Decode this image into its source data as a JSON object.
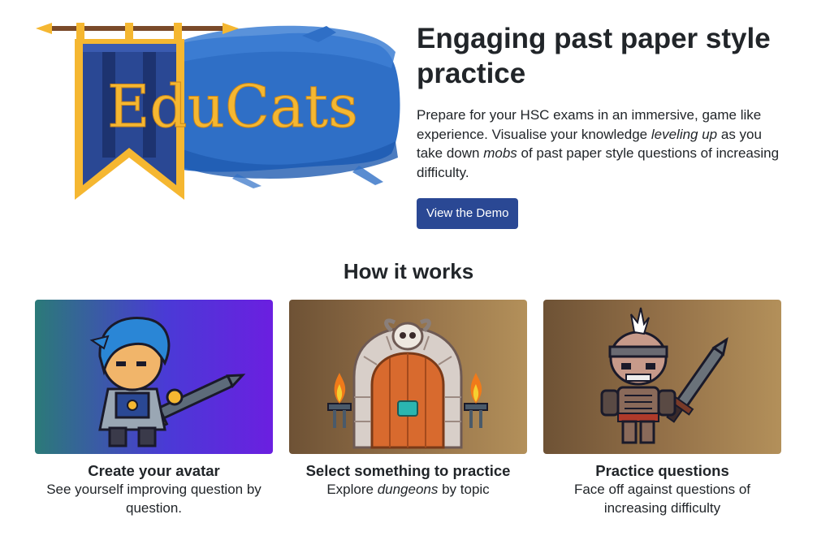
{
  "logo": {
    "text": "EduCats"
  },
  "hero": {
    "title": "Engaging past paper style practice",
    "description_parts": [
      {
        "text": "Prepare for your HSC exams in an immersive, game like experience. Visualise your knowledge ",
        "italic": false
      },
      {
        "text": "leveling up",
        "italic": true
      },
      {
        "text": " as you take down ",
        "italic": false
      },
      {
        "text": "mobs",
        "italic": true
      },
      {
        "text": " of past paper style questions of increasing difficulty.",
        "italic": false
      }
    ],
    "button_label": "View the Demo"
  },
  "how_it_works": {
    "title": "How it works",
    "cards": [
      {
        "title": "Create your avatar",
        "description_parts": [
          {
            "text": "See yourself improving question by question.",
            "italic": false
          }
        ],
        "image": "knight-avatar-icon",
        "gradient": [
          "#2b7a78",
          "#6b1fe0"
        ]
      },
      {
        "title": "Select something to practice",
        "description_parts": [
          {
            "text": "Explore ",
            "italic": false
          },
          {
            "text": "dungeons",
            "italic": true
          },
          {
            "text": " by topic",
            "italic": false
          }
        ],
        "image": "dungeon-door-icon",
        "gradient": [
          "#6e5235",
          "#b3905a"
        ]
      },
      {
        "title": "Practice questions",
        "description_parts": [
          {
            "text": "Face off against questions of increasing difficulty",
            "italic": false
          }
        ],
        "image": "skeleton-warrior-icon",
        "gradient": [
          "#6e5235",
          "#b3905a"
        ]
      }
    ]
  },
  "colors": {
    "primary_button": "#2a4894",
    "banner_blue": "#2a4894",
    "banner_gold": "#f5b731",
    "paint_blue": "#2f6fc6"
  }
}
